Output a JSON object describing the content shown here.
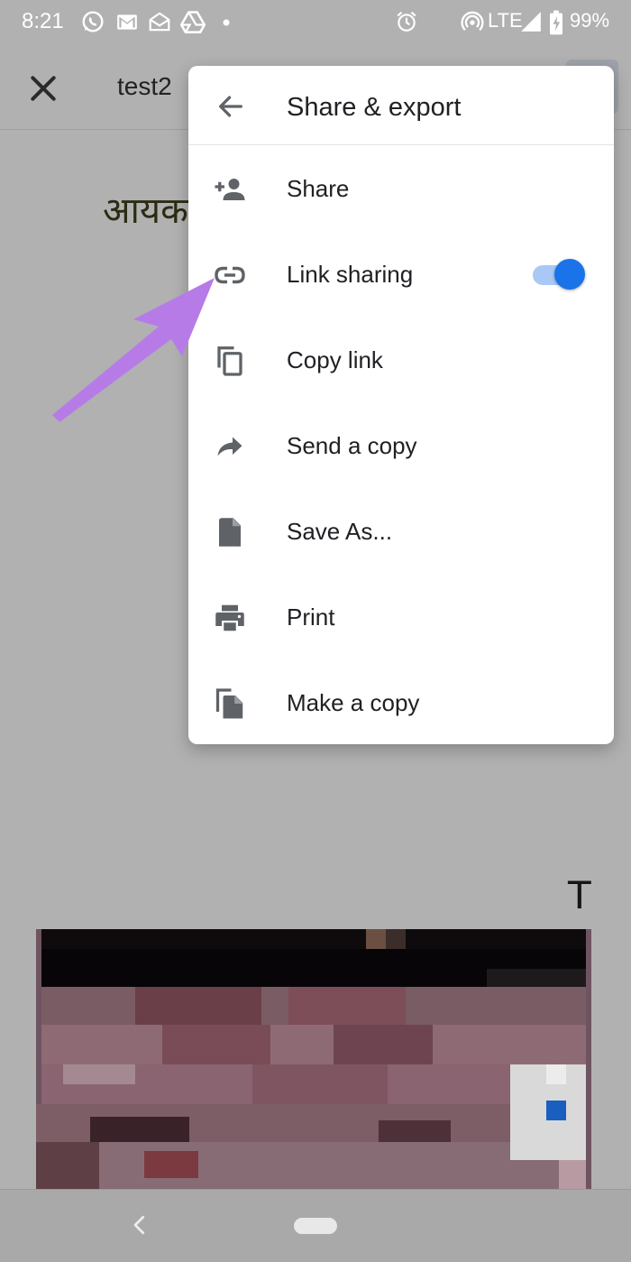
{
  "status_bar": {
    "time": "8:21",
    "network": "LTE",
    "battery": "99%"
  },
  "app_bar": {
    "doc_title": "test2"
  },
  "document": {
    "heading": "आयक",
    "letter": "T"
  },
  "menu": {
    "title": "Share & export",
    "items": [
      {
        "label": "Share",
        "icon": "add-person-icon"
      },
      {
        "label": "Link sharing",
        "icon": "link-icon",
        "toggle_on": true
      },
      {
        "label": "Copy link",
        "icon": "copy-icon"
      },
      {
        "label": "Send a copy",
        "icon": "forward-arrow-icon"
      },
      {
        "label": "Save As...",
        "icon": "file-icon"
      },
      {
        "label": "Print",
        "icon": "printer-icon"
      },
      {
        "label": "Make a copy",
        "icon": "make-copy-icon"
      }
    ]
  },
  "colors": {
    "accent": "#1a73e8",
    "toggle_track": "#a9c8f5",
    "overlay_arrow": "#b77be8",
    "scrim": "#b1b1b1"
  }
}
